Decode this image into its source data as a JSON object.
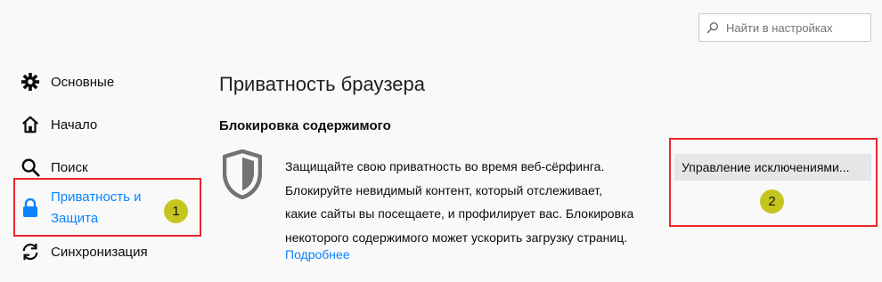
{
  "search": {
    "placeholder": "Найти в настройках",
    "icon": "search-icon"
  },
  "sidebar": {
    "items": [
      {
        "label": "Основные",
        "icon": "gear-icon"
      },
      {
        "label": "Начало",
        "icon": "home-icon"
      },
      {
        "label": "Поиск",
        "icon": "search-icon"
      },
      {
        "label_line1": "Приватность и",
        "label_line2": "Защита",
        "icon": "lock-icon",
        "selected": true
      },
      {
        "label": "Синхронизация",
        "icon": "sync-icon"
      }
    ]
  },
  "main": {
    "page_title": "Приватность браузера",
    "section_title": "Блокировка содержимого",
    "description_lines": [
      "Защищайте свою приватность во время веб-сёрфинга.",
      "Блокируйте невидимый контент, который отслеживает,",
      "какие сайты вы посещаете, и профилирует вас. Блокировка",
      "некоторого содержимого может ускорить загрузку страниц."
    ],
    "learn_more": "Подробнее",
    "manage_exceptions": "Управление исключениями..."
  },
  "annotations": {
    "badge1": "1",
    "badge2": "2"
  },
  "colors": {
    "accent": "#0a84ff",
    "callout": "#e8262c",
    "badge": "#c5c51f"
  }
}
